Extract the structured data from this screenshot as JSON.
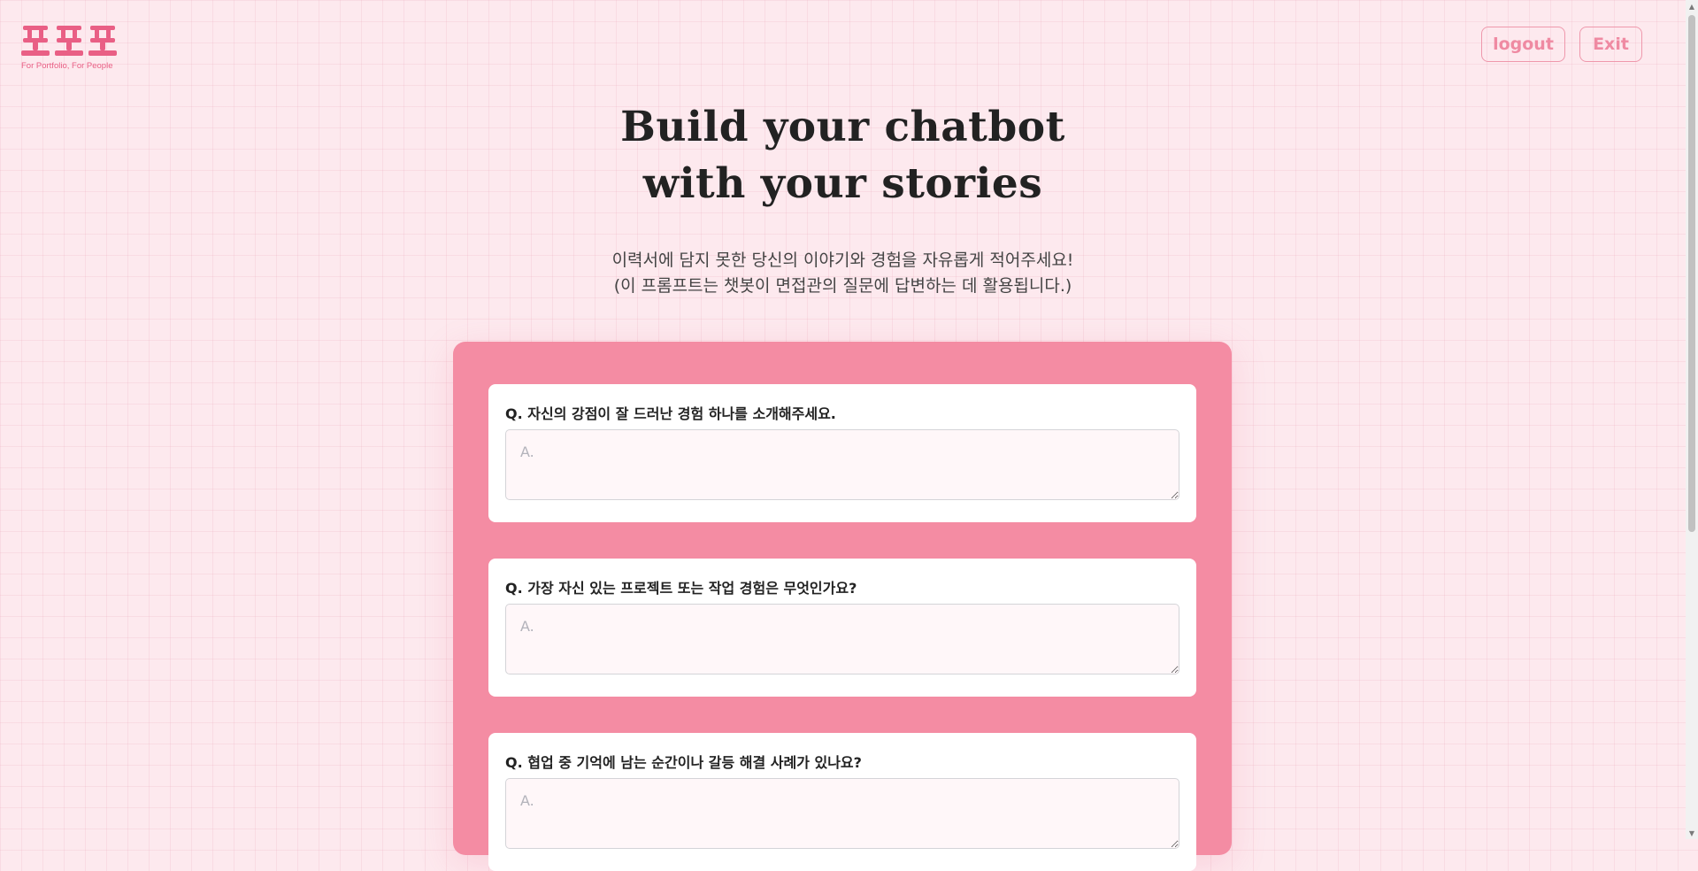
{
  "header": {
    "logo_text": "포포포",
    "logo_caption": "For Portfolio, For People",
    "logout_label": "logout",
    "exit_label": "Exit"
  },
  "hero": {
    "title_line1": "Build your chatbot",
    "title_line2": "with your stories",
    "subtitle_line1": "이력서에 담지 못한 당신의 이야기와 경험을 자유롭게 적어주세요!",
    "subtitle_line2": "(이 프롬프트는 챗봇이 면접관의 질문에 답변하는 데 활용됩니다.)"
  },
  "questions": [
    {
      "label": "Q. 자신의 강점이 잘 드러난 경험 하나를 소개해주세요.",
      "placeholder": "A.",
      "value": ""
    },
    {
      "label": "Q. 가장 자신 있는 프로젝트 또는 작업 경험은 무엇인가요?",
      "placeholder": "A.",
      "value": ""
    },
    {
      "label": "Q. 협업 중 기억에 남는 순간이나 갈등 해결 사례가 있나요?",
      "placeholder": "A.",
      "value": ""
    }
  ],
  "colors": {
    "brand": "#e95f85",
    "page_background": "#fde9ee",
    "panel": "#f48ca3",
    "button_border": "#ef98ac"
  },
  "icons": {
    "scroll_up": "triangle-up",
    "scroll_down": "triangle-down"
  }
}
